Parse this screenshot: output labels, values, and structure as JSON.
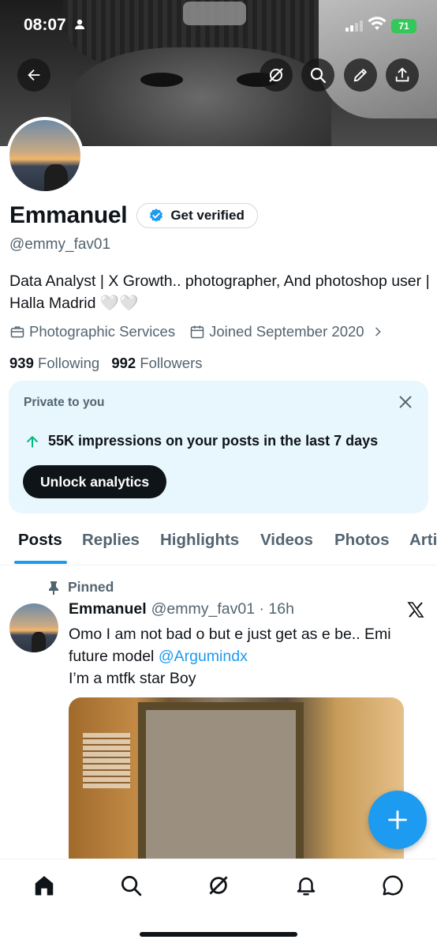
{
  "status_bar": {
    "time": "08:07",
    "battery": "71"
  },
  "profile": {
    "name": "Emmanuel",
    "verify_button": "Get verified",
    "handle": "@emmy_fav01",
    "bio": "Data Analyst | X Growth.. photographer, And photoshop user | Halla Madrid 🤍🤍",
    "category": "Photographic Services",
    "joined": "Joined September 2020",
    "following_count": "939",
    "following_label": "Following",
    "followers_count": "992",
    "followers_label": "Followers"
  },
  "analytics_card": {
    "header": "Private to you",
    "impressions": "55K impressions on your posts in the last 7 days",
    "button": "Unlock analytics"
  },
  "tabs": [
    "Posts",
    "Replies",
    "Highlights",
    "Videos",
    "Photos",
    "Arti"
  ],
  "post": {
    "pinned_label": "Pinned",
    "author": "Emmanuel",
    "meta": "@emmy_fav01 · 16h",
    "text_before_mention": "Omo I am not bad o but e just get as e be.. Emi future model ",
    "mention": "@Argumindx",
    "text_line2": "I’m a mtfk star Boy"
  },
  "colors": {
    "accent": "#1d9bf0",
    "card_bg": "#e8f7fd",
    "up_arrow": "#00ba7c",
    "battery": "#34c759"
  },
  "icons": [
    "back-arrow-icon",
    "grok-icon",
    "search-icon",
    "edit-icon",
    "share-icon",
    "briefcase-icon",
    "calendar-icon",
    "close-icon",
    "arrow-up-icon",
    "pin-icon",
    "x-logo-icon",
    "plus-icon",
    "home-icon",
    "explore-icon",
    "grok-nav-icon",
    "notifications-icon",
    "messages-icon"
  ]
}
